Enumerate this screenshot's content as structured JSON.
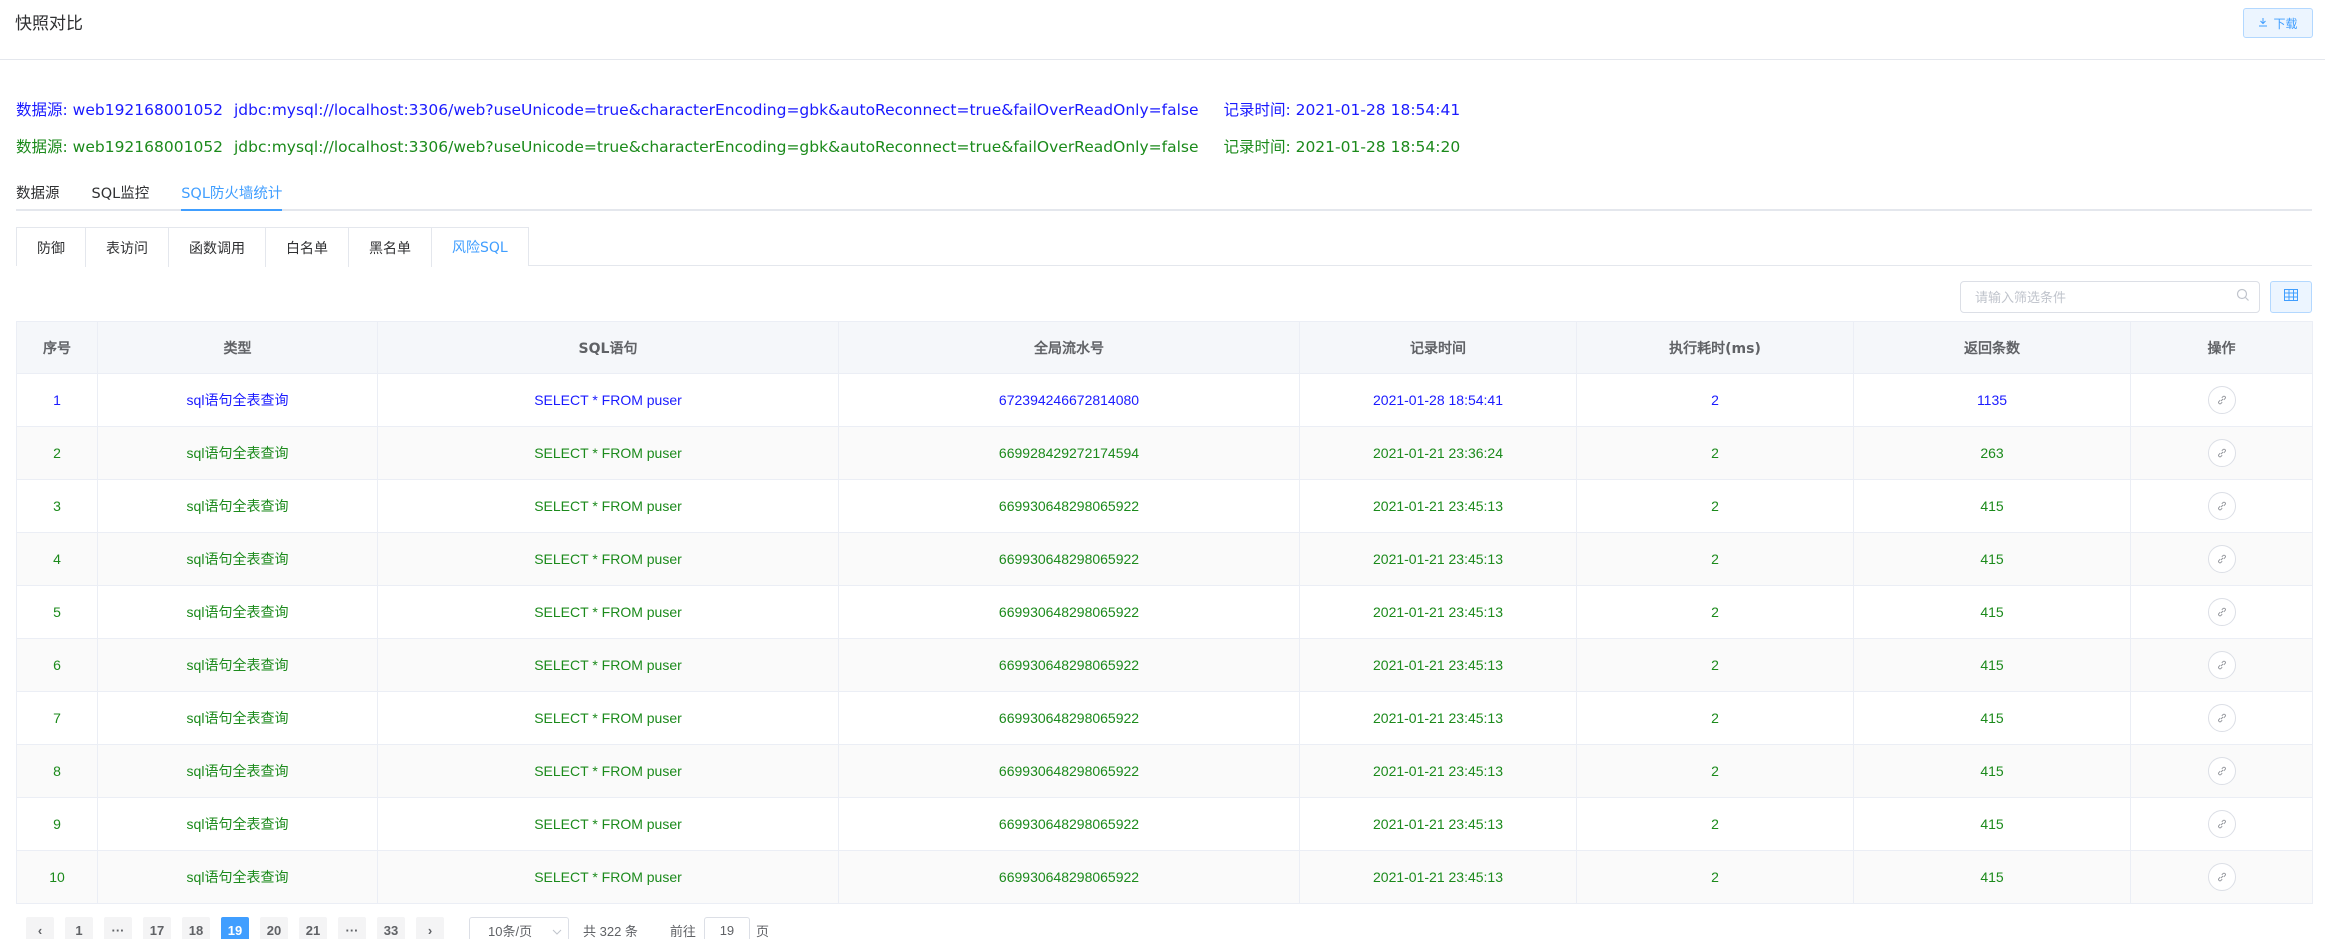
{
  "header": {
    "title": "快照对比",
    "download_label": "下载"
  },
  "datasources": [
    {
      "prefix": "数据源: web192168001052",
      "url": "jdbc:mysql://localhost:3306/web?useUnicode=true&characterEncoding=gbk&autoReconnect=true&failOverReadOnly=false",
      "time": "记录时间: 2021-01-28 18:54:41",
      "color": "#1a1aff"
    },
    {
      "prefix": "数据源: web192168001052",
      "url": "jdbc:mysql://localhost:3306/web?useUnicode=true&characterEncoding=gbk&autoReconnect=true&failOverReadOnly=false",
      "time": "记录时间: 2021-01-28 18:54:20",
      "color": "#1b8a1b"
    }
  ],
  "main_tabs": [
    {
      "label": "数据源",
      "active": false
    },
    {
      "label": "SQL监控",
      "active": false
    },
    {
      "label": "SQL防火墙统计",
      "active": true
    }
  ],
  "sub_tabs": [
    {
      "label": "防御",
      "active": false
    },
    {
      "label": "表访问",
      "active": false
    },
    {
      "label": "函数调用",
      "active": false
    },
    {
      "label": "白名单",
      "active": false
    },
    {
      "label": "黑名单",
      "active": false
    },
    {
      "label": "风险SQL",
      "active": true
    }
  ],
  "search": {
    "placeholder": "请输入筛选条件"
  },
  "table": {
    "columns": [
      "序号",
      "类型",
      "SQL语句",
      "全局流水号",
      "记录时间",
      "执行耗时(ms)",
      "返回条数",
      "操作"
    ],
    "rows": [
      [
        "1",
        "sql语句全表查询",
        "SELECT * FROM puser",
        "672394246672814080",
        "2021-01-28 18:54:41",
        "2",
        "1135"
      ],
      [
        "2",
        "sql语句全表查询",
        "SELECT * FROM puser",
        "669928429272174594",
        "2021-01-21 23:36:24",
        "2",
        "263"
      ],
      [
        "3",
        "sql语句全表查询",
        "SELECT * FROM puser",
        "669930648298065922",
        "2021-01-21 23:45:13",
        "2",
        "415"
      ],
      [
        "4",
        "sql语句全表查询",
        "SELECT * FROM puser",
        "669930648298065922",
        "2021-01-21 23:45:13",
        "2",
        "415"
      ],
      [
        "5",
        "sql语句全表查询",
        "SELECT * FROM puser",
        "669930648298065922",
        "2021-01-21 23:45:13",
        "2",
        "415"
      ],
      [
        "6",
        "sql语句全表查询",
        "SELECT * FROM puser",
        "669930648298065922",
        "2021-01-21 23:45:13",
        "2",
        "415"
      ],
      [
        "7",
        "sql语句全表查询",
        "SELECT * FROM puser",
        "669930648298065922",
        "2021-01-21 23:45:13",
        "2",
        "415"
      ],
      [
        "8",
        "sql语句全表查询",
        "SELECT * FROM puser",
        "669930648298065922",
        "2021-01-21 23:45:13",
        "2",
        "415"
      ],
      [
        "9",
        "sql语句全表查询",
        "SELECT * FROM puser",
        "669930648298065922",
        "2021-01-21 23:45:13",
        "2",
        "415"
      ],
      [
        "10",
        "sql语句全表查询",
        "SELECT * FROM puser",
        "669930648298065922",
        "2021-01-21 23:45:13",
        "2",
        "415"
      ]
    ],
    "row_colors": [
      "blue",
      "green",
      "green",
      "green",
      "green",
      "green",
      "green",
      "green",
      "green",
      "green"
    ]
  },
  "pagination": {
    "prev": "‹",
    "pages": [
      "1",
      "···",
      "17",
      "18",
      "19",
      "20",
      "21",
      "···",
      "33"
    ],
    "current": "19",
    "next": "›",
    "page_size": "10条/页",
    "total": "共 322 条",
    "goto_label": "前往",
    "goto_value": "19",
    "page_unit": "页"
  },
  "colors": {
    "accent": "#409eff",
    "blue_text": "#1a1aff",
    "green_text": "#1b8a1b"
  },
  "icons": {
    "download": "download-icon",
    "search": "search-icon",
    "grid": "grid-icon",
    "link": "link-icon"
  }
}
